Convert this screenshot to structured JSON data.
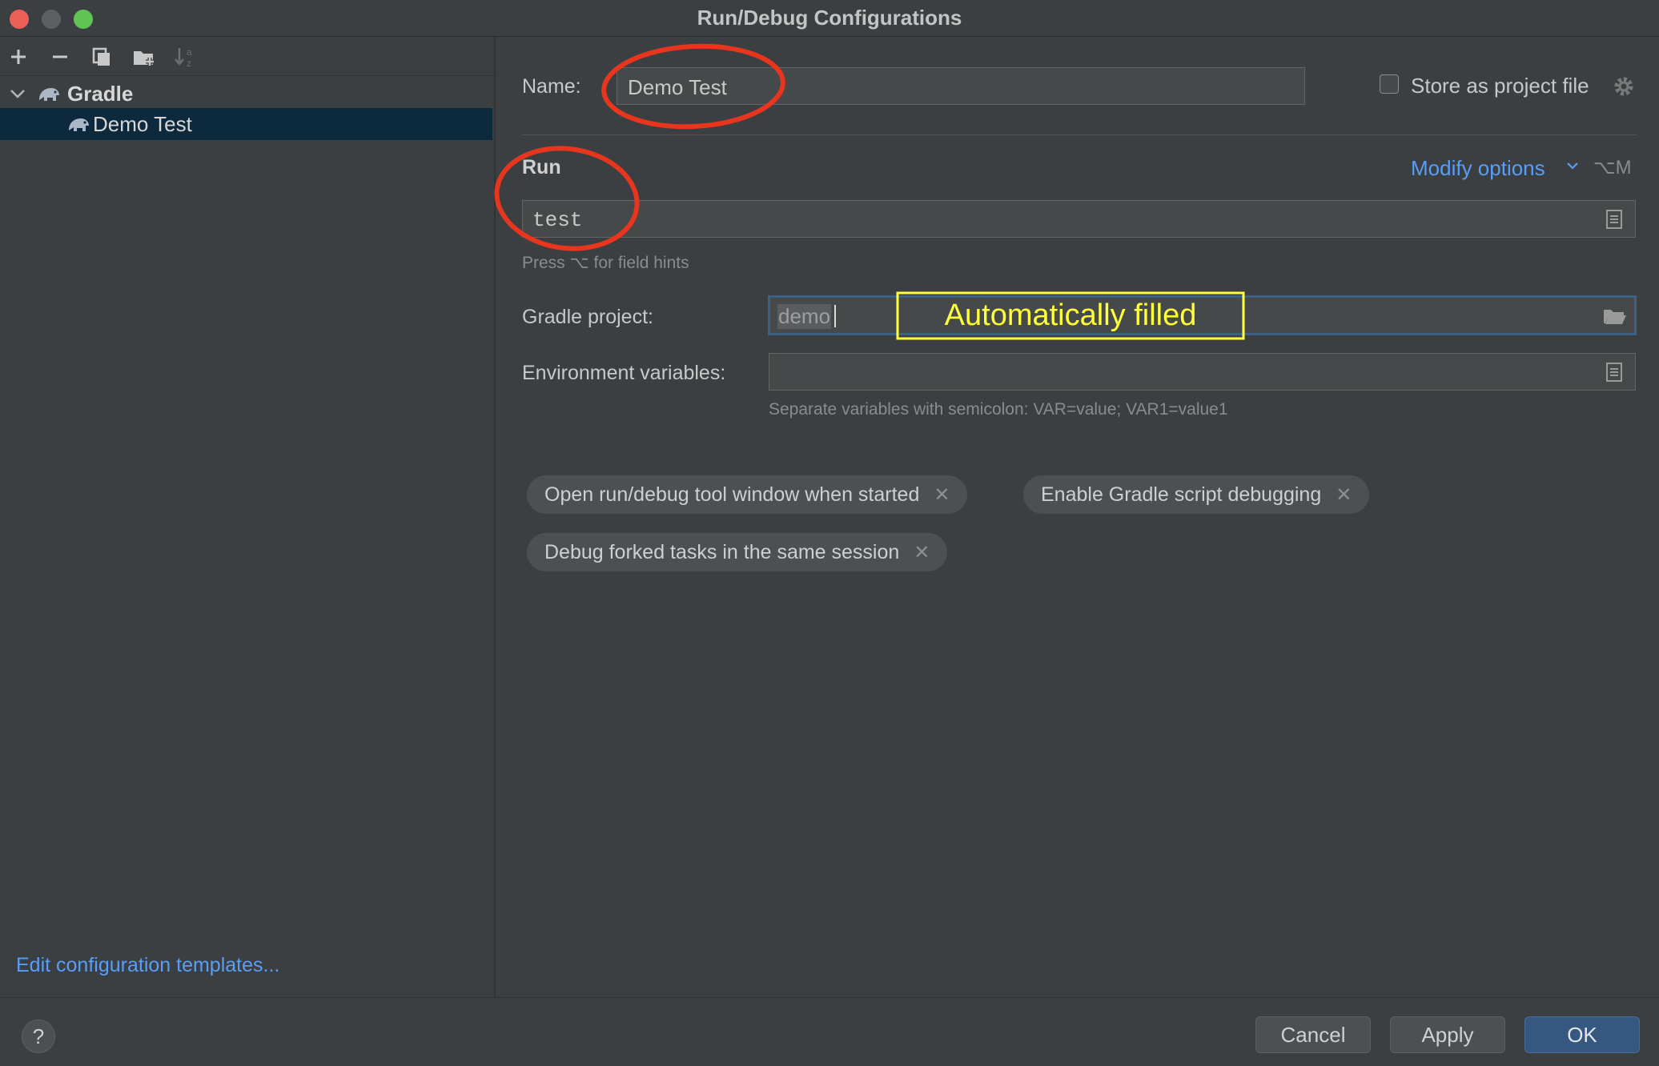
{
  "window": {
    "title": "Run/Debug Configurations"
  },
  "toolbar": {
    "add_icon": "plus-icon",
    "remove_icon": "minus-icon",
    "copy_icon": "copy-icon",
    "folder_icon": "new-folder-icon",
    "sort_icon": "sort-az-icon"
  },
  "tree": {
    "group_label": "Gradle",
    "item_label": "Demo Test"
  },
  "left_footer": {
    "edit_templates_link": "Edit configuration templates..."
  },
  "form": {
    "name_label": "Name:",
    "name_value": "Demo Test",
    "store_label": "Store as project file",
    "run_heading": "Run",
    "modify_options": "Modify options",
    "modify_shortcut": "⌥M",
    "run_value": "test",
    "run_hint": "Press ⌥ for field hints",
    "gradle_project_label": "Gradle project:",
    "gradle_project_value": "demo",
    "env_label": "Environment variables:",
    "env_value": "",
    "env_hint": "Separate variables with semicolon: VAR=value; VAR1=value1"
  },
  "chips": [
    {
      "label": "Open run/debug tool window when started"
    },
    {
      "label": "Enable Gradle script debugging"
    },
    {
      "label": "Debug forked tasks in the same session"
    }
  ],
  "annotation": {
    "text": "Automatically filled",
    "color": "#ffff3a",
    "circle_color": "#e8361e"
  },
  "buttons": {
    "help": "?",
    "cancel": "Cancel",
    "apply": "Apply",
    "ok": "OK"
  },
  "colors": {
    "accent": "#589df6",
    "ok_button": "#365880",
    "selection": "#0d293e"
  }
}
